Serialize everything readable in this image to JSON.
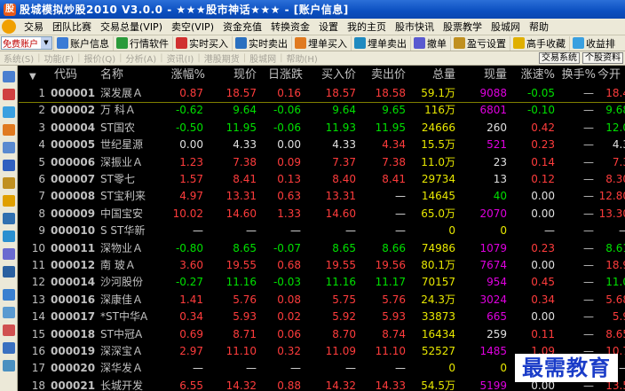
{
  "window": {
    "title": "股城模拟炒股2010 V3.0.0  - ★★★股市神话★★★ - [账户信息]"
  },
  "menu": [
    "交易",
    "团队比赛",
    "交易总量(VIP)",
    "卖空(VIP)",
    "资金充值",
    "转换资金",
    "设置",
    "我的主页",
    "股市快讯",
    "股票教学",
    "股城网",
    "帮助"
  ],
  "toolbar": {
    "account_select": "免费账户",
    "buttons": [
      "账户信息",
      "行情软件",
      "实时买入",
      "实时卖出",
      "埋单买入",
      "埋单卖出",
      "撤单",
      "盈亏设置",
      "高手收藏",
      "收益排"
    ]
  },
  "subbar": {
    "items": [
      "系统(S)",
      "功能(F)",
      "报价(Q)",
      "分析(A)",
      "资讯(I)",
      "港股期货",
      "股城网",
      "帮助(H)"
    ],
    "right_buttons": [
      "交易系统",
      "个股资料"
    ]
  },
  "grid": {
    "headers": {
      "index": "▼",
      "code": "代码",
      "name": "名称",
      "chg": "涨幅%",
      "price": "现价",
      "upd": "日涨跌",
      "bid": "买入价",
      "ask": "卖出价",
      "vol": "总量",
      "cur": "现量",
      "spd": "涨速%",
      "turn": "换手%",
      "open": "今开"
    },
    "rows": [
      {
        "idx": "1",
        "code": "000001",
        "name": "深发展Ａ",
        "chg": "0.87",
        "price": "18.57",
        "upd": "0.16",
        "bid": "18.57",
        "ask": "18.58",
        "vol": "59.1万",
        "cur": "9088",
        "spd": "-0.05",
        "turn": "—",
        "open": "18.4",
        "dir": "up",
        "cur_color": "purple"
      },
      {
        "idx": "2",
        "code": "000002",
        "name": "万  科Ａ",
        "chg": "-0.62",
        "price": "9.64",
        "upd": "-0.06",
        "bid": "9.64",
        "ask": "9.65",
        "vol": "116万",
        "cur": "6801",
        "spd": "-0.10",
        "turn": "—",
        "open": "9.68",
        "dir": "down",
        "cur_color": "purple"
      },
      {
        "idx": "3",
        "code": "000004",
        "name": "ST国农",
        "chg": "-0.50",
        "price": "11.95",
        "upd": "-0.06",
        "bid": "11.93",
        "ask": "11.95",
        "vol": "24666",
        "cur": "260",
        "spd": "0.42",
        "turn": "—",
        "open": "12.0",
        "dir": "down",
        "cur_color": "white"
      },
      {
        "idx": "4",
        "code": "000005",
        "name": "世纪星源",
        "chg": "0.00",
        "price": "4.33",
        "upd": "0.00",
        "bid": "4.33",
        "ask": "4.34",
        "vol": "15.5万",
        "cur": "521",
        "spd": "0.23",
        "turn": "—",
        "open": "4.3",
        "dir": "flat",
        "cur_color": "purple"
      },
      {
        "idx": "5",
        "code": "000006",
        "name": "深振业Ａ",
        "chg": "1.23",
        "price": "7.38",
        "upd": "0.09",
        "bid": "7.37",
        "ask": "7.38",
        "vol": "11.0万",
        "cur": "23",
        "spd": "0.14",
        "turn": "—",
        "open": "7.3",
        "dir": "up",
        "cur_color": "white"
      },
      {
        "idx": "6",
        "code": "000007",
        "name": "ST零七",
        "chg": "1.57",
        "price": "8.41",
        "upd": "0.13",
        "bid": "8.40",
        "ask": "8.41",
        "vol": "29734",
        "cur": "13",
        "spd": "0.12",
        "turn": "—",
        "open": "8.30",
        "dir": "up",
        "cur_color": "white"
      },
      {
        "idx": "7",
        "code": "000008",
        "name": "ST宝利来",
        "chg": "4.97",
        "price": "13.31",
        "upd": "0.63",
        "bid": "13.31",
        "ask": "—",
        "vol": "14645",
        "cur": "40",
        "spd": "0.00",
        "turn": "—",
        "open": "12.80",
        "dir": "up",
        "cur_color": "green"
      },
      {
        "idx": "8",
        "code": "000009",
        "name": "中国宝安",
        "chg": "10.02",
        "price": "14.60",
        "upd": "1.33",
        "bid": "14.60",
        "ask": "—",
        "vol": "65.0万",
        "cur": "2070",
        "spd": "0.00",
        "turn": "—",
        "open": "13.30",
        "dir": "up",
        "cur_color": "purple"
      },
      {
        "idx": "9",
        "code": "000010",
        "name": "S ST华新",
        "chg": "—",
        "price": "—",
        "upd": "—",
        "bid": "—",
        "ask": "—",
        "vol": "0",
        "cur": "0",
        "spd": "—",
        "turn": "—",
        "open": "—",
        "dir": "none",
        "cur_color": "yellow"
      },
      {
        "idx": "10",
        "code": "000011",
        "name": "深物业Ａ",
        "chg": "-0.80",
        "price": "8.65",
        "upd": "-0.07",
        "bid": "8.65",
        "ask": "8.66",
        "vol": "74986",
        "cur": "1079",
        "spd": "0.23",
        "turn": "—",
        "open": "8.61",
        "dir": "down",
        "cur_color": "purple"
      },
      {
        "idx": "11",
        "code": "000012",
        "name": "南  玻Ａ",
        "chg": "3.60",
        "price": "19.55",
        "upd": "0.68",
        "bid": "19.55",
        "ask": "19.56",
        "vol": "80.1万",
        "cur": "7674",
        "spd": "0.00",
        "turn": "—",
        "open": "18.9",
        "dir": "up",
        "cur_color": "purple"
      },
      {
        "idx": "12",
        "code": "000014",
        "name": "沙河股份",
        "chg": "-0.27",
        "price": "11.16",
        "upd": "-0.03",
        "bid": "11.16",
        "ask": "11.17",
        "vol": "70157",
        "cur": "954",
        "spd": "0.45",
        "turn": "—",
        "open": "11.0",
        "dir": "down",
        "cur_color": "purple"
      },
      {
        "idx": "13",
        "code": "000016",
        "name": "深康佳Ａ",
        "chg": "1.41",
        "price": "5.76",
        "upd": "0.08",
        "bid": "5.75",
        "ask": "5.76",
        "vol": "24.3万",
        "cur": "3024",
        "spd": "0.34",
        "turn": "—",
        "open": "5.68",
        "dir": "up",
        "cur_color": "purple"
      },
      {
        "idx": "14",
        "code": "000017",
        "name": "*ST中华A",
        "chg": "0.34",
        "price": "5.93",
        "upd": "0.02",
        "bid": "5.92",
        "ask": "5.93",
        "vol": "33873",
        "cur": "665",
        "spd": "0.00",
        "turn": "—",
        "open": "5.9",
        "dir": "up",
        "cur_color": "purple"
      },
      {
        "idx": "15",
        "code": "000018",
        "name": "ST中冠A",
        "chg": "0.69",
        "price": "8.71",
        "upd": "0.06",
        "bid": "8.70",
        "ask": "8.74",
        "vol": "16434",
        "cur": "259",
        "spd": "0.11",
        "turn": "—",
        "open": "8.65",
        "dir": "up",
        "cur_color": "white"
      },
      {
        "idx": "16",
        "code": "000019",
        "name": "深深宝Ａ",
        "chg": "2.97",
        "price": "11.10",
        "upd": "0.32",
        "bid": "11.09",
        "ask": "11.10",
        "vol": "52527",
        "cur": "1485",
        "spd": "1.09",
        "turn": "—",
        "open": "10.7",
        "dir": "up",
        "cur_color": "purple"
      },
      {
        "idx": "17",
        "code": "000020",
        "name": "深华发Ａ",
        "chg": "—",
        "price": "—",
        "upd": "—",
        "bid": "—",
        "ask": "—",
        "vol": "0",
        "cur": "0",
        "spd": "—",
        "turn": "—",
        "open": "—",
        "dir": "none",
        "cur_color": "yellow"
      },
      {
        "idx": "18",
        "code": "000021",
        "name": "长城开发",
        "chg": "6.55",
        "price": "14.32",
        "upd": "0.88",
        "bid": "14.32",
        "ask": "14.33",
        "vol": "54.5万",
        "cur": "5199",
        "spd": "0.00",
        "turn": "—",
        "open": "13.5",
        "dir": "up",
        "cur_color": "purple"
      }
    ]
  },
  "colors": {
    "up": "#ff3c3c",
    "down": "#00e000",
    "flat": "#e0e0e0",
    "purple": "#e000e0",
    "white": "#e0e0e0",
    "green": "#00e000",
    "yellow": "#e8e800"
  },
  "watermark": "最需教育"
}
